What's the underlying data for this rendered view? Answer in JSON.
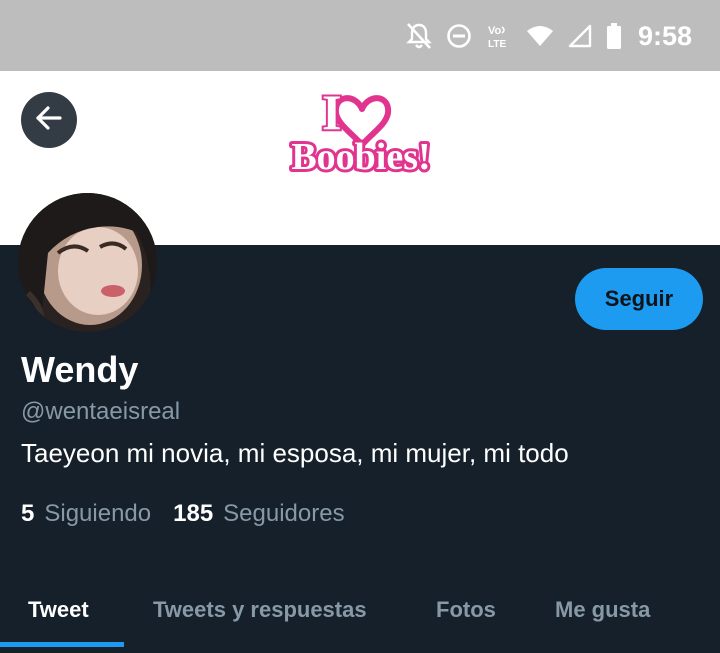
{
  "status_bar": {
    "time": "9:58",
    "icons": [
      "notifications-off-icon",
      "do-not-disturb-icon",
      "volte-lte-icon",
      "wifi-icon",
      "cellular-signal-icon",
      "battery-icon"
    ],
    "volte_line1": "Vo",
    "volte_line2": "LTE"
  },
  "banner": {
    "logo_line1": "I",
    "logo_line2": "Boobies!",
    "logo_color": "#e0348f"
  },
  "profile": {
    "display_name": "Wendy",
    "handle": "@wentaeisreal",
    "bio": "Taeyeon mi novia, mi esposa, mi mujer, mi todo",
    "follow_label": "Seguir",
    "stats": {
      "following_count": "5",
      "following_label": "Siguiendo",
      "followers_count": "185",
      "followers_label": "Seguidores"
    }
  },
  "tabs": [
    {
      "label": "Tweet",
      "active": true
    },
    {
      "label": "Tweets y respuestas",
      "active": false
    },
    {
      "label": "Fotos",
      "active": false
    },
    {
      "label": "Me gusta",
      "active": false
    }
  ],
  "colors": {
    "accent": "#1d9bf0",
    "background": "#15202b",
    "muted_text": "#8899a6",
    "status_bar": "#bdbdbd"
  }
}
